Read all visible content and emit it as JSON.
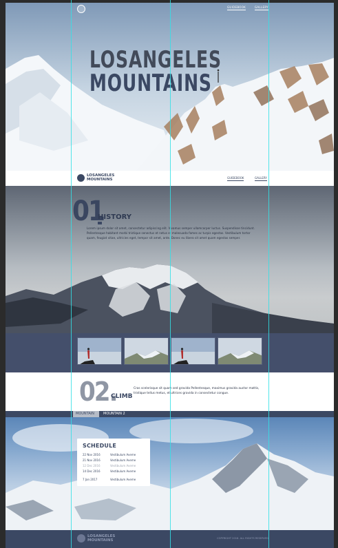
{
  "hero": {
    "title_line1": "LOSANGELES",
    "title_line2": "MOUNTAINS",
    "nav": [
      "GUIDEBOOK",
      "GALLERY"
    ]
  },
  "header": {
    "logo_line1": "LOSANGELES",
    "logo_line2": "MOUNTAINS",
    "nav": [
      "GUIDEBOOK",
      "GALLERY"
    ]
  },
  "history": {
    "number": "01",
    "label": "HISTORY",
    "text": "Lorem ipsum dolor sit amet, consectetur adipiscing elit. Vivamus semper ullamcorper luctus. Suspendisse tincidunt. Pellentesque habitant morbi tristique senectus et netus et malesuada fames ac turpis egestas. Vestibulum tortor quam, feugiat vitae, ultricies eget, tempor sit amet, ante. Donec eu libero sit amet quam egestas semper."
  },
  "climb": {
    "number": "02.",
    "label": "CLIMB",
    "text": "Cras scelerisque sit quam sed gravida Pellentesque, maximus gravida auctor mattis, tristique tellus metus, et ultrices gravida in consectetur congue."
  },
  "tabs": [
    "MOUNTAIN 1",
    "MOUNTAIN 2"
  ],
  "schedule": {
    "title": "SCHEDULE",
    "rows": [
      {
        "date": "22 Nov 2016",
        "place": "Vestibulum Aveme",
        "muted": false
      },
      {
        "date": "21 Nov 2016",
        "place": "Vestibulum Aveme",
        "muted": false
      },
      {
        "date": "12 Dec 2016",
        "place": "Vestibulum Aveme",
        "muted": true
      },
      {
        "date": "14 Dec 2016",
        "place": "Vestibulum Aveme",
        "muted": false
      },
      {
        "date": "7 Jan 2017",
        "place": "Vestibulum Aveme",
        "muted": false
      }
    ]
  },
  "footer": {
    "logo_line1": "LOSANGELES",
    "logo_line2": "MOUNTAINS",
    "copyright": "COPYRIGHT 2016. ALL RIGHTS RESERVED"
  },
  "colors": {
    "navy": "#3b4863",
    "guide": "#33e0e6"
  }
}
